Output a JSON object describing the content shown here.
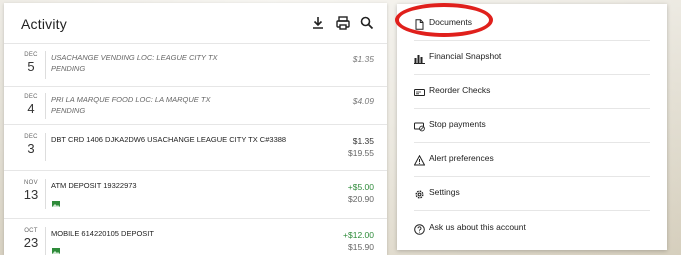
{
  "activity": {
    "title": "Activity",
    "icons": [
      "download-icon",
      "print-icon",
      "search-icon"
    ],
    "transactions": [
      {
        "month": "DEC",
        "day": "5",
        "description": "USACHANGE VENDING LOC: LEAGUE CITY TX",
        "status": "PENDING",
        "amount": "$1.35",
        "balance": "",
        "pending": true,
        "credit": false,
        "has_image": false
      },
      {
        "month": "DEC",
        "day": "4",
        "description": "PRI LA MARQUE FOOD LOC: LA MARQUE TX",
        "status": "PENDING",
        "amount": "$4.09",
        "balance": "",
        "pending": true,
        "credit": false,
        "has_image": false
      },
      {
        "month": "DEC",
        "day": "3",
        "description": "DBT CRD 1406 DJKA2DW6 USACHANGE LEAGUE CITY TX C#3388",
        "status": "",
        "amount": "$1.35",
        "balance": "$19.55",
        "pending": false,
        "credit": false,
        "has_image": false
      },
      {
        "month": "NOV",
        "day": "13",
        "description": "ATM DEPOSIT 19322973",
        "status": "",
        "amount": "+$5.00",
        "balance": "$20.90",
        "pending": false,
        "credit": true,
        "has_image": true
      },
      {
        "month": "OCT",
        "day": "23",
        "description": "MOBILE 614220105 DEPOSIT",
        "status": "",
        "amount": "+$12.00",
        "balance": "$15.90",
        "pending": false,
        "credit": true,
        "has_image": true
      }
    ]
  },
  "menu": {
    "items": [
      {
        "label": "Documents",
        "icon": "document-icon"
      },
      {
        "label": "Financial Snapshot",
        "icon": "bar-chart-icon"
      },
      {
        "label": "Reorder Checks",
        "icon": "check-icon"
      },
      {
        "label": "Stop payments",
        "icon": "stop-payment-icon"
      },
      {
        "label": "Alert preferences",
        "icon": "alert-icon"
      },
      {
        "label": "Settings",
        "icon": "gear-icon"
      },
      {
        "label": "Ask us about this account",
        "icon": "help-icon"
      }
    ]
  },
  "colors": {
    "credit": "#2e8b3a",
    "highlight": "#e0201c"
  }
}
